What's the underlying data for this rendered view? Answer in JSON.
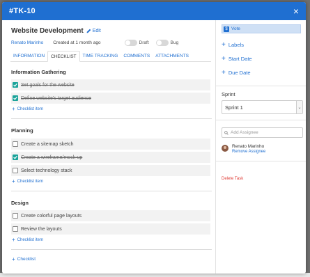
{
  "modal": {
    "title": "#TK-10",
    "close": "×"
  },
  "task": {
    "name": "Website Development",
    "edit_label": "Edit",
    "author": "Renato Marinho",
    "created": "Created at 1 month ago",
    "toggles": [
      {
        "label": "Draft"
      },
      {
        "label": "Bug"
      }
    ]
  },
  "tabs": [
    {
      "label": "INFORMATION"
    },
    {
      "label": "CHECKLIST"
    },
    {
      "label": "TIME TRACKING"
    },
    {
      "label": "COMMENTS"
    },
    {
      "label": "ATTACHMENTS"
    }
  ],
  "checklists": [
    {
      "title": "Information Gathering",
      "items": [
        {
          "label": "Set goals for the website",
          "done": true
        },
        {
          "label": "Define website's target audience",
          "done": true
        }
      ],
      "add_label": "Checklist item"
    },
    {
      "title": "Planning",
      "items": [
        {
          "label": "Create a sitemap sketch",
          "done": false
        },
        {
          "label": "Create a wireframe/mock-up",
          "done": true
        },
        {
          "label": "Select technology stack",
          "done": false
        }
      ],
      "add_label": "Checklist item"
    },
    {
      "title": "Design",
      "items": [
        {
          "label": "Create colorful page layouts",
          "done": false
        },
        {
          "label": "Review the layouts",
          "done": false
        }
      ],
      "add_label": "Checklist item"
    }
  ],
  "add_checklist_label": "Checklist",
  "sidebar": {
    "vote_label": "Vote",
    "links": [
      {
        "label": "Labels"
      },
      {
        "label": "Start Date"
      },
      {
        "label": "Due Date"
      }
    ],
    "sprint_label": "Sprint",
    "sprint_value": "Sprint 1",
    "assignee_placeholder": "Add Assignee",
    "assignee_name": "Renato Marinho",
    "remove_assignee": "Remove Assignee",
    "delete_task": "Delete Task"
  },
  "colors": {
    "header": "#1f6fd1",
    "checkbox_checked": "#1aa39a",
    "delete": "#e0403a"
  }
}
